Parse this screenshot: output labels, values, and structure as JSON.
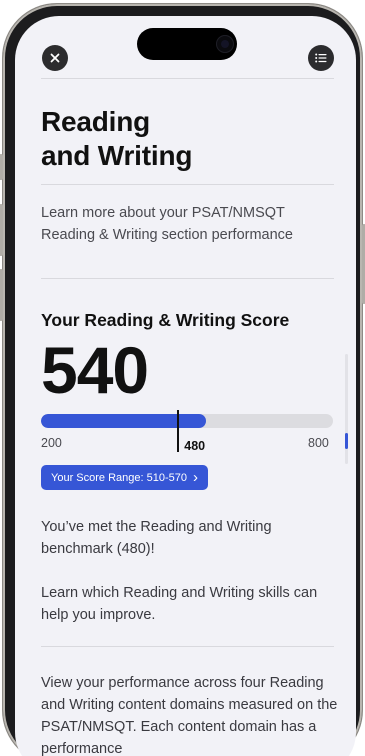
{
  "colors": {
    "accent": "#3656d6",
    "background": "#f2f2f7",
    "text": "#111111",
    "track": "#dcdce0"
  },
  "header": {
    "close_icon": "close-icon",
    "menu_icon": "list-menu-icon"
  },
  "title": {
    "line1": "Reading",
    "line2": "and Writing"
  },
  "intro": "Learn more about your PSAT/NMSQT Reading & Writing section performance",
  "score": {
    "label": "Your Reading & Writing Score",
    "value": "540",
    "scale_min": 200,
    "scale_max": 800,
    "benchmark": 480,
    "scale_min_label": "200",
    "scale_max_label": "800",
    "benchmark_label": "480",
    "range_label": "Your Score Range: 510-570",
    "range_chevron": "›"
  },
  "benchmark_text": "You’ve met the Reading and Writing benchmark (480)!",
  "skills_text": "Learn which Reading and Writing skills can help you improve.",
  "domains_text": "View your performance across four Reading and Writing content domains measured on the PSAT/NMSQT.  Each content domain has a performance"
}
